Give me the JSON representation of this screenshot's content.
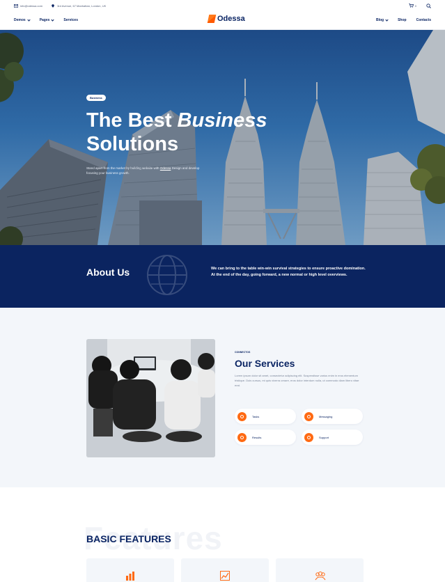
{
  "topbar": {
    "email": "info@odessa.com",
    "address": "3rd Avenue, 67 Manhattan, London, UK",
    "cart_count": "0"
  },
  "nav": {
    "left_items": [
      "Demos",
      "Pages",
      "Services"
    ],
    "brand": "Odessa",
    "right_items": [
      "Blog",
      "Shop",
      "Contacts"
    ]
  },
  "hero": {
    "tag": "Business",
    "title_plain": "The Best",
    "title_emph": "Business",
    "title_line2": "Solutions",
    "desc_before": "Stand apart from the market by building website with",
    "desc_link": "Odessa",
    "desc_after": "Design and develop focusing your business growth."
  },
  "about": {
    "title": "About Us",
    "text": "We can bring to the table win-win survival strategies to ensure proactive domination. At the end of the day, going forward, a new normal or high level overviews."
  },
  "services": {
    "kicker": "CONNECTOS",
    "title": "Our Services",
    "text": "Lorem ipsum dolor sit amet, consectetur adipiscing elit. Suspendisse varius enim in eros elementum tristique. Duis cursus, mi quis viverra ornare, eros dolor interdum nulla, ut commodo diam libero vitae erat.",
    "chips": [
      "Tasks",
      "Messaging",
      "Results",
      "Support"
    ],
    "accent": "#ff6a13"
  },
  "features": {
    "ghost": "Features",
    "title": "BASIC FEATURES"
  },
  "colors": {
    "navy": "#0b2460",
    "brand_orange": "#ff6a13"
  }
}
